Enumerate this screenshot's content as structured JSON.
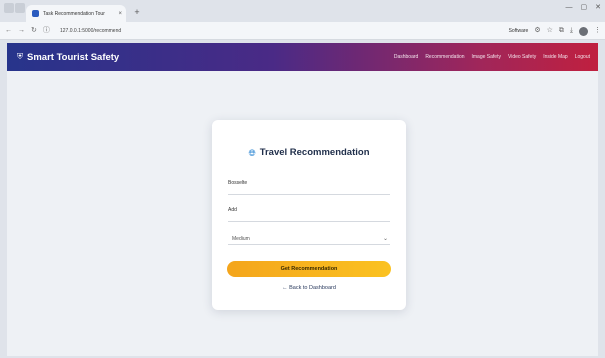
{
  "browser": {
    "tab_title": "Task Recommendation Tour",
    "tab_close": "×",
    "new_tab": "+",
    "url": "127.0.0.1:5000/recommend",
    "software_label": "Software"
  },
  "nav": {
    "brand": "Smart Tourist Safety",
    "links": [
      "Dashboard",
      "Recommendation",
      "Image Safety",
      "Video Safety",
      "Inside Map",
      "Logout"
    ]
  },
  "card": {
    "title": "Travel Recommendation",
    "fields": {
      "first_label": "Bosselte",
      "second_label": "Add",
      "select_value": "Medium"
    },
    "submit_label": "Get Recommendation",
    "back_label": "← Back to Dashboard"
  }
}
